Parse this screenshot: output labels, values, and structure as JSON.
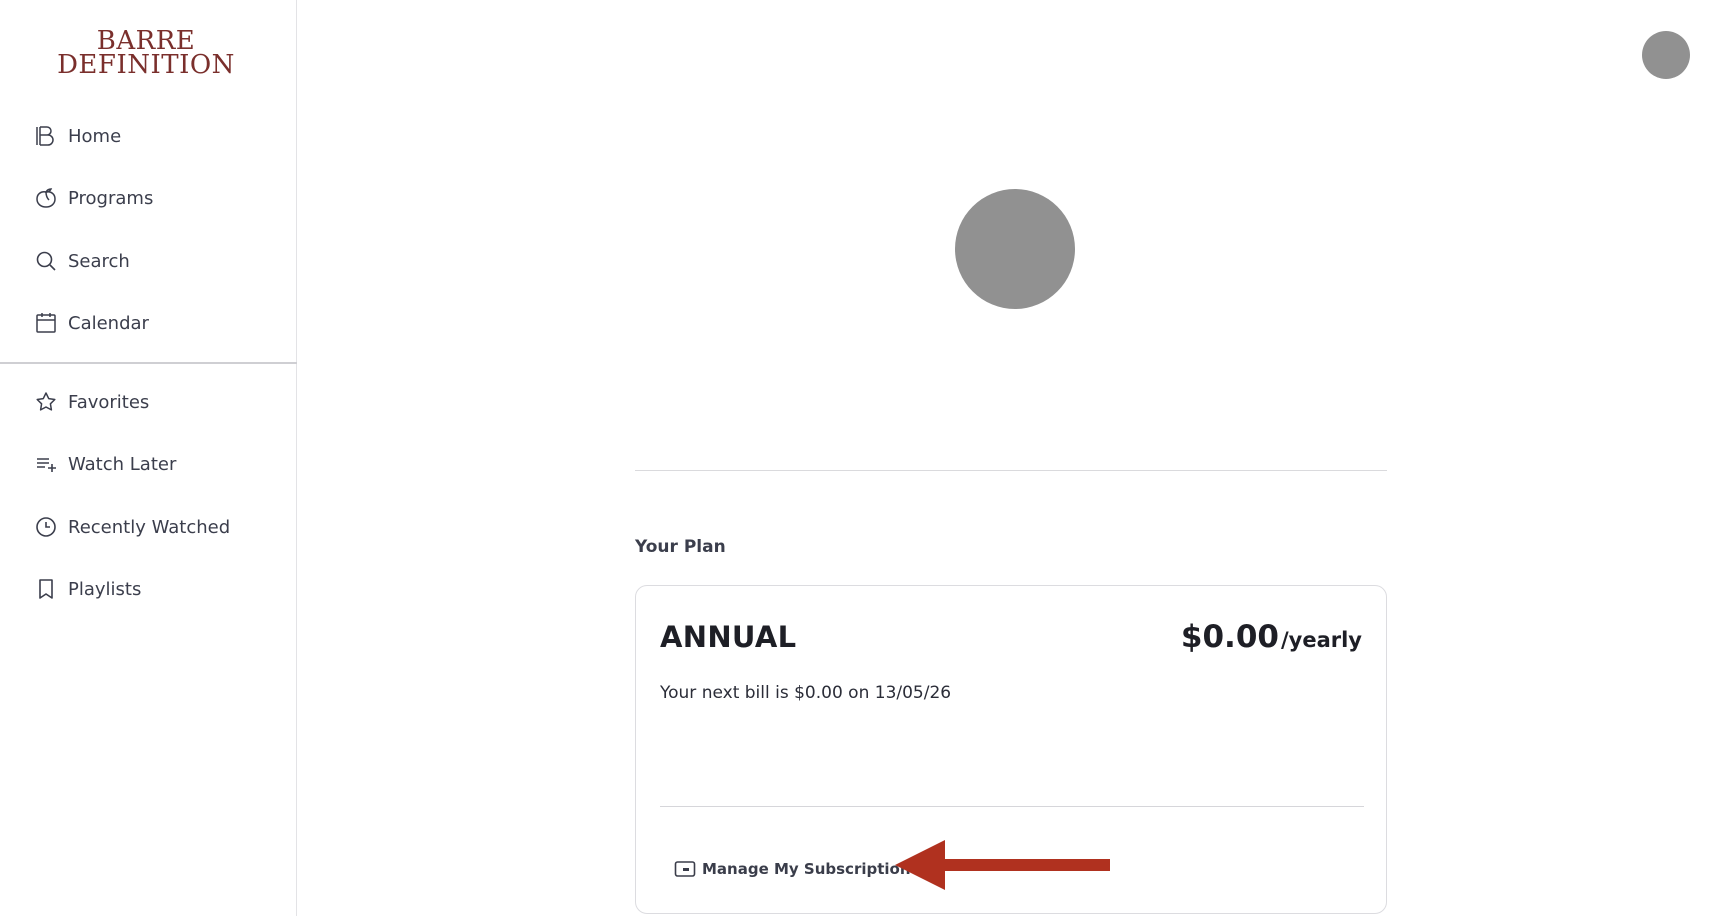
{
  "brand": {
    "line1": "BARRE",
    "line2": "DEFINITION",
    "color": "#7a2f2c"
  },
  "sidebar": {
    "items": [
      {
        "label": "Home",
        "icon": "brand-b-icon"
      },
      {
        "label": "Programs",
        "icon": "peach-icon"
      },
      {
        "label": "Search",
        "icon": "search-icon"
      },
      {
        "label": "Calendar",
        "icon": "calendar-icon"
      },
      {
        "label": "Favorites",
        "icon": "star-icon"
      },
      {
        "label": "Watch Later",
        "icon": "playlist-add-icon"
      },
      {
        "label": "Recently Watched",
        "icon": "clock-icon"
      },
      {
        "label": "Playlists",
        "icon": "bookmark-icon"
      }
    ]
  },
  "plan": {
    "heading": "Your Plan",
    "name": "ANNUAL",
    "price": "$0.00",
    "period": "/yearly",
    "bill_text": "Your next bill is $0.00 on 13/05/26",
    "manage_label": "Manage My Subscription"
  },
  "colors": {
    "annotation_arrow": "#b0311f",
    "avatar_placeholder": "#919191"
  }
}
